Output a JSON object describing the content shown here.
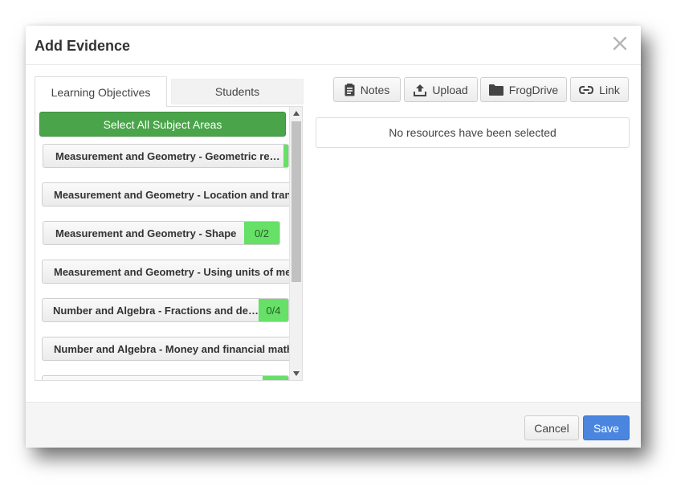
{
  "dialog": {
    "title": "Add Evidence",
    "close_icon": "close-icon"
  },
  "tabs": [
    {
      "label": "Learning Objectives",
      "active": true
    },
    {
      "label": "Students",
      "active": false
    }
  ],
  "objectives": {
    "select_all_label": "Select All Subject Areas",
    "select_all_color": "#4aa54a",
    "badge_color": "#66e066",
    "items": [
      {
        "label": "Measurement and Geometry - Geometric reasoning",
        "badge": ""
      },
      {
        "label": "Measurement and Geometry - Location and transformation",
        "badge": ""
      },
      {
        "label": "Measurement and Geometry - Shape",
        "badge": "0/2"
      },
      {
        "label": "Measurement and Geometry - Using units of measurement",
        "badge": ""
      },
      {
        "label": "Number and Algebra - Fractions and decimals",
        "badge": "0/4"
      },
      {
        "label": "Number and Algebra - Money and financial mathematics",
        "badge": ""
      },
      {
        "label": "",
        "badge": ""
      }
    ]
  },
  "toolbar": {
    "notes_label": "Notes",
    "notes_icon": "notes-icon",
    "upload_label": "Upload",
    "upload_icon": "upload-icon",
    "frogdrive_label": "FrogDrive",
    "frogdrive_icon": "folder-icon",
    "link_label": "Link",
    "link_icon": "link-icon"
  },
  "resources": {
    "empty_message": "No resources have been selected"
  },
  "footer": {
    "cancel_label": "Cancel",
    "save_label": "Save",
    "save_color": "#4a86e0"
  }
}
